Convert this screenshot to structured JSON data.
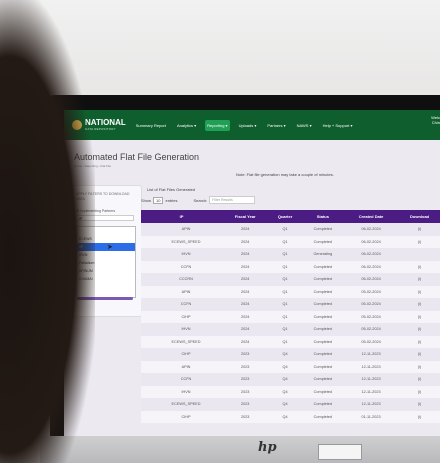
{
  "brand": {
    "name": "NATIONAL",
    "sub": "DATA REPOSITORY"
  },
  "nav": [
    {
      "label": "Summary Report"
    },
    {
      "label": "Analytics ▾"
    },
    {
      "label": "Reporting ▾"
    },
    {
      "label": "Uploads ▾"
    },
    {
      "label": "Partners ▾"
    },
    {
      "label": "NAWS ▾"
    },
    {
      "label": "Help + Support ▾"
    }
  ],
  "user": {
    "line1": "Welc",
    "line2": "Chin"
  },
  "page": {
    "title": "Automated Flat File Generation",
    "breadcrumb": "Home › Reporting › Flat File",
    "note": "Note: Flat file generation may take a couple of minutes."
  },
  "filter": {
    "heading": "APPLY FILTERS TO DOWNLOAD DATA",
    "sub": "⊞ Implementing Partners",
    "select_value": "IP",
    "items": [
      {
        "label": ""
      },
      {
        "label": "ECEWS"
      },
      {
        "label": "IIP"
      },
      {
        "label": "IHVN"
      },
      {
        "label": "Palladium"
      },
      {
        "label": "APIN/JM"
      },
      {
        "label": "CHAMAI"
      }
    ]
  },
  "list": {
    "title": "List of Flat Files Generated",
    "show_label": "Show",
    "entries_value": "10",
    "entries_label": "entries",
    "search_label": "Search:",
    "search_placeholder": "Filter Results"
  },
  "table": {
    "headers": [
      "IP",
      "Fiscal Year",
      "Quarter",
      "Status",
      "Created Date",
      "Download"
    ],
    "rows": [
      [
        "APIN",
        "2024",
        "Q1",
        "Completed",
        "06-02-2024",
        "(i)"
      ],
      [
        "ECEWS_SPEED",
        "2024",
        "Q1",
        "Completed",
        "06-02-2024",
        "(i)"
      ],
      [
        "IHVN",
        "2024",
        "Q1",
        "Generating",
        "06-02-2024",
        ""
      ],
      [
        "CCFN",
        "2024",
        "Q1",
        "Completed",
        "06-02-2024",
        "(i)"
      ],
      [
        "CCCRN",
        "2024",
        "Q1",
        "Completed",
        "06-02-2024",
        "(i)"
      ],
      [
        "APIN",
        "2024",
        "Q1",
        "Completed",
        "05-02-2024",
        "(i)"
      ],
      [
        "CCFN",
        "2024",
        "Q1",
        "Completed",
        "05-02-2024",
        "(i)"
      ],
      [
        "CIHP",
        "2024",
        "Q1",
        "Completed",
        "05-02-2024",
        "(i)"
      ],
      [
        "IHVN",
        "2024",
        "Q1",
        "Completed",
        "05-02-2024",
        "(i)"
      ],
      [
        "ECEWS_SPEED",
        "2024",
        "Q1",
        "Completed",
        "05-02-2024",
        "(i)"
      ],
      [
        "CIHP",
        "2023",
        "Q4",
        "Completed",
        "12-11-2023",
        "(i)"
      ],
      [
        "APIN",
        "2023",
        "Q4",
        "Completed",
        "12-11-2023",
        "(i)"
      ],
      [
        "CCFN",
        "2023",
        "Q4",
        "Completed",
        "12-11-2023",
        "(i)"
      ],
      [
        "IHVN",
        "2023",
        "Q4",
        "Completed",
        "12-11-2023",
        "(i)"
      ],
      [
        "ECEWS_SPEED",
        "2023",
        "Q4",
        "Completed",
        "12-11-2023",
        "(i)"
      ],
      [
        "CIHP",
        "2023",
        "Q4",
        "Completed",
        "01-11-2023",
        "(i)"
      ]
    ]
  },
  "colors": {
    "topbar": "#0f5f2e",
    "active_nav": "#1fa055",
    "table_header": "#4b1c83",
    "selected": "#2b6ee8"
  },
  "monitor": {
    "logo": "hp"
  }
}
